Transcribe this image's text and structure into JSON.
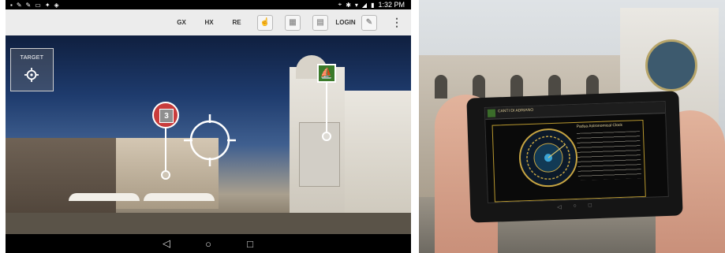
{
  "status_bar": {
    "left_icons": [
      "notification-icon",
      "wrench-icon",
      "wrench-icon",
      "message-icon",
      "pin-icon",
      "image-icon"
    ],
    "left_glyphs": [
      "▪",
      "✎",
      "✎",
      "▭",
      "✦",
      "◈"
    ],
    "right_icons": [
      "location-icon",
      "bluetooth-icon",
      "wifi-icon",
      "signal-icon",
      "battery-icon"
    ],
    "right_glyphs": [
      "⌖",
      "✱",
      "▾",
      "◢",
      "▮"
    ],
    "time": "1:32 PM"
  },
  "toolbar": {
    "items": [
      {
        "label": "GX"
      },
      {
        "label": "HX"
      },
      {
        "label": "RE"
      }
    ],
    "icons": [
      "glove-icon",
      "map-icon",
      "document-icon"
    ],
    "icon_glyphs": [
      "☝",
      "▦",
      "▤"
    ],
    "login_label": "LOGIN",
    "settings_icon_glyph": "✎",
    "more_glyph": "⋮"
  },
  "ar_view": {
    "target_button_label": "TARGET",
    "poi_count": "3",
    "marker_green_glyph": "⛵"
  },
  "nav_bar": {
    "back_glyph": "◁",
    "home_glyph": "○",
    "recents_glyph": "□"
  },
  "photo_device": {
    "app_title": "CANTI DI ADRIANO",
    "panel_title": "Padua Astronomical Clock",
    "nav_glyphs": [
      "◁",
      "○",
      "□"
    ]
  },
  "colors": {
    "marker_red": "#c83c3c",
    "marker_green": "#3b7a2a",
    "toolbar_bg": "#ececec"
  }
}
